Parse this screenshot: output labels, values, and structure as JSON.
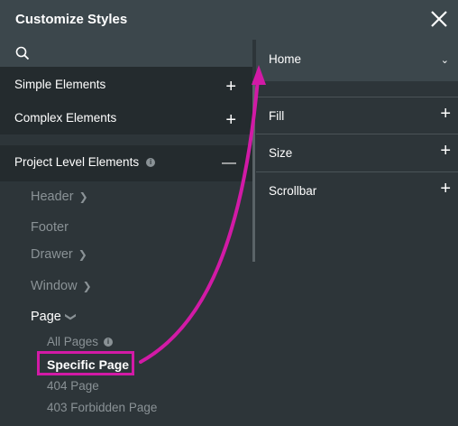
{
  "dialog": {
    "title": "Customize Styles"
  },
  "left": {
    "sections": [
      {
        "label": "Simple Elements",
        "sign": "+"
      },
      {
        "label": "Complex Elements",
        "sign": "+"
      },
      {
        "label": "Project Level Elements",
        "sign": "—"
      }
    ],
    "tree": {
      "header": "Header",
      "footer": "Footer",
      "drawer": "Drawer",
      "window": "Window",
      "page": "Page",
      "all_pages": "All Pages",
      "specific_page": "Specific Page",
      "page_404": "404 Page",
      "page_403": "403 Forbidden Page"
    }
  },
  "right": {
    "selected": "Home",
    "rows": [
      {
        "label": "Fill",
        "sign": "+"
      },
      {
        "label": "Size",
        "sign": "+"
      },
      {
        "label": "Scrollbar",
        "sign": "+"
      }
    ]
  },
  "colors": {
    "accent": "#d21aa6",
    "panel": "#2d3539",
    "header": "#3c474c"
  }
}
